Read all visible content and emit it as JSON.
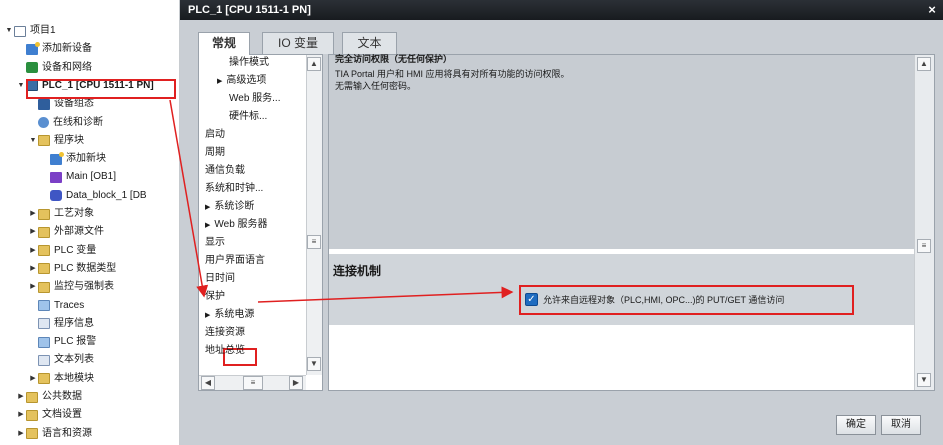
{
  "tree": {
    "items": [
      {
        "label": "项目1",
        "indent": 0,
        "twisty": "▼",
        "icon": "project-icon",
        "cls": "project"
      },
      {
        "label": "添加新设备",
        "indent": 1,
        "twisty": "",
        "icon": "add-device-icon",
        "cls": "add"
      },
      {
        "label": "设备和网络",
        "indent": 1,
        "twisty": "",
        "icon": "network-icon",
        "cls": "net"
      },
      {
        "label": "PLC_1 [CPU 1511-1 PN]",
        "indent": 1,
        "twisty": "▼",
        "icon": "plc-icon",
        "cls": "plc",
        "bold": true
      },
      {
        "label": "设备组态",
        "indent": 2,
        "twisty": "",
        "icon": "device-config-icon",
        "cls": "dev"
      },
      {
        "label": "在线和诊断",
        "indent": 2,
        "twisty": "",
        "icon": "diagnostics-icon",
        "cls": "diag"
      },
      {
        "label": "程序块",
        "indent": 2,
        "twisty": "▼",
        "icon": "folder-icon",
        "cls": "folder"
      },
      {
        "label": "添加新块",
        "indent": 3,
        "twisty": "",
        "icon": "add-block-icon",
        "cls": "add"
      },
      {
        "label": "Main [OB1]",
        "indent": 3,
        "twisty": "",
        "icon": "ob-icon",
        "cls": "ob"
      },
      {
        "label": "Data_block_1 [DB",
        "indent": 3,
        "twisty": "",
        "icon": "db-icon",
        "cls": "db"
      },
      {
        "label": "工艺对象",
        "indent": 2,
        "twisty": "▶",
        "icon": "folder-icon",
        "cls": "folder"
      },
      {
        "label": "外部源文件",
        "indent": 2,
        "twisty": "▶",
        "icon": "folder-icon",
        "cls": "folder"
      },
      {
        "label": "PLC 变量",
        "indent": 2,
        "twisty": "▶",
        "icon": "folder-icon",
        "cls": "folder"
      },
      {
        "label": "PLC 数据类型",
        "indent": 2,
        "twisty": "▶",
        "icon": "folder-icon",
        "cls": "folder"
      },
      {
        "label": "监控与强制表",
        "indent": 2,
        "twisty": "▶",
        "icon": "folder-icon",
        "cls": "folder"
      },
      {
        "label": "Traces",
        "indent": 2,
        "twisty": "",
        "icon": "traces-icon",
        "cls": "alarm"
      },
      {
        "label": "程序信息",
        "indent": 2,
        "twisty": "",
        "icon": "program-info-icon",
        "cls": "doc"
      },
      {
        "label": "PLC 报警",
        "indent": 2,
        "twisty": "",
        "icon": "plc-alarm-icon",
        "cls": "alarm"
      },
      {
        "label": "文本列表",
        "indent": 2,
        "twisty": "",
        "icon": "text-list-icon",
        "cls": "doc"
      },
      {
        "label": "本地模块",
        "indent": 2,
        "twisty": "▶",
        "icon": "folder-icon",
        "cls": "folder"
      },
      {
        "label": "公共数据",
        "indent": 1,
        "twisty": "▶",
        "icon": "folder-icon",
        "cls": "folder"
      },
      {
        "label": "文档设置",
        "indent": 1,
        "twisty": "▶",
        "icon": "folder-icon",
        "cls": "folder"
      },
      {
        "label": "语言和资源",
        "indent": 1,
        "twisty": "▶",
        "icon": "folder-icon",
        "cls": "folder"
      }
    ]
  },
  "dialog": {
    "title": "PLC_1 [CPU 1511-1 PN]",
    "close": "×",
    "tabs": [
      "常规",
      "IO 变量",
      "文本"
    ],
    "nav_items": [
      {
        "label": "操作模式",
        "indent": 2,
        "arrow": ""
      },
      {
        "label": "高级选项",
        "indent": 1,
        "arrow": "▶"
      },
      {
        "label": "Web 服务...",
        "indent": 2,
        "arrow": ""
      },
      {
        "label": "硬件标...",
        "indent": 2,
        "arrow": ""
      },
      {
        "label": "启动",
        "indent": 0,
        "arrow": ""
      },
      {
        "label": "周期",
        "indent": 0,
        "arrow": ""
      },
      {
        "label": "通信负载",
        "indent": 0,
        "arrow": ""
      },
      {
        "label": "系统和时钟...",
        "indent": 0,
        "arrow": ""
      },
      {
        "label": "系统诊断",
        "indent": 0,
        "arrow": "▶"
      },
      {
        "label": "Web 服务器",
        "indent": 0,
        "arrow": "▶"
      },
      {
        "label": "显示",
        "indent": 0,
        "arrow": ""
      },
      {
        "label": "用户界面语言",
        "indent": 0,
        "arrow": ""
      },
      {
        "label": "日时间",
        "indent": 0,
        "arrow": ""
      },
      {
        "label": "保护",
        "indent": 0,
        "arrow": "",
        "selected": true
      },
      {
        "label": "系统电源",
        "indent": 0,
        "arrow": "▶"
      },
      {
        "label": "连接资源",
        "indent": 0,
        "arrow": ""
      },
      {
        "label": "地址总览",
        "indent": 0,
        "arrow": ""
      }
    ],
    "top_text": [
      "完全访问权限（无任何保护）",
      "TIA Portal 用户和 HMI 应用将具有对所有功能的访问权限。",
      "无需输入任何密码。"
    ],
    "connection": {
      "title": "连接机制",
      "checkbox_label": "允许来自远程对象（PLC,HMI, OPC...)的 PUT/GET 通信访问",
      "checked": true
    },
    "buttons": {
      "ok": "确定",
      "cancel": "取消"
    },
    "scroll": {
      "up": "▲",
      "down": "▼",
      "left": "◀",
      "right": "▶",
      "grip": "≡"
    }
  },
  "colors": {
    "highlight": "#e02020",
    "titlebar": "#1f2328",
    "checkbox": "#1f6cc0"
  }
}
